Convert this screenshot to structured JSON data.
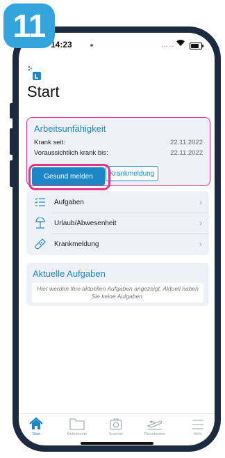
{
  "step": {
    "number": "11"
  },
  "status_bar": {
    "time": "14:23",
    "signal": "....."
  },
  "app": {
    "title": "Start"
  },
  "arbeitsunfaehigkeit": {
    "title": "Arbeitsunfähigkeit",
    "rows": [
      {
        "label": "Krank seit:",
        "value": "22.11.2022"
      },
      {
        "label": "Voraussichtlich krank bis:",
        "value": "22.11.2022"
      }
    ],
    "primary_button": "Gesund melden",
    "secondary_button": "Krankmeldung"
  },
  "menu": {
    "items": [
      {
        "label": "Aufgaben",
        "icon": "checklist-icon"
      },
      {
        "label": "Urlaub/Abwesenheit",
        "icon": "beach-umbrella-icon"
      },
      {
        "label": "Krankmeldung",
        "icon": "thermometer-icon"
      }
    ],
    "chevron": "›"
  },
  "tasks": {
    "title": "Aktuelle Aufgaben",
    "empty_text": "Hier werden Ihre aktuellen Aufgaben angezeigt. Aktuell haben Sie keine Aufgaben."
  },
  "tabbar": {
    "tabs": [
      {
        "label": "Start",
        "icon": "home-icon",
        "active": true
      },
      {
        "label": "Dokumente",
        "icon": "folder-icon",
        "active": false
      },
      {
        "label": "Scanner",
        "icon": "camera-icon",
        "active": false
      },
      {
        "label": "Reisekosten",
        "icon": "airplane-icon",
        "active": false
      },
      {
        "label": "Mehr",
        "icon": "menu-icon",
        "active": false
      }
    ]
  },
  "colors": {
    "accent": "#1b87c8",
    "highlight": "#e6348c",
    "badge": "#34a4dc",
    "card_bg": "#eef1f6",
    "frame": "#1c2a3f"
  }
}
